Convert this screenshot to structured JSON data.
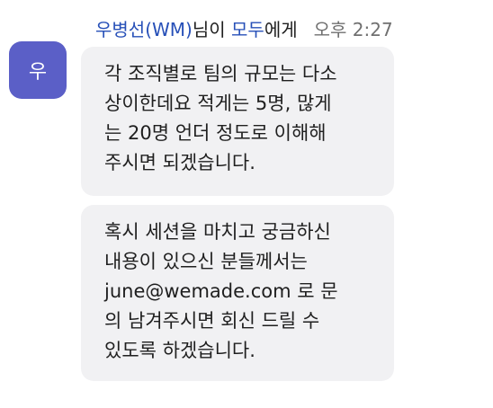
{
  "sender": {
    "avatar_initial": "우",
    "avatar_color": "#5b5fc7",
    "name": "우병선(WM)",
    "suffix": "님이 ",
    "target": "모두",
    "target_suffix": "에게",
    "time": "오후 2:27",
    "link_color": "#2750b8"
  },
  "messages": [
    {
      "lines": [
        "각 조직별로 팀의 규모는 다소",
        "상이한데요 적게는 5명, 많게",
        "는 20명 언더 정도로 이해해",
        "주시면 되겠습니다."
      ]
    },
    {
      "lines": [
        "혹시 세션을 마치고 궁금하신",
        "내용이 있으신 분들께서는",
        "june@wemade.com 로 문",
        "의 남겨주시면 회신 드릴 수",
        "있도록 하겠습니다."
      ]
    }
  ]
}
